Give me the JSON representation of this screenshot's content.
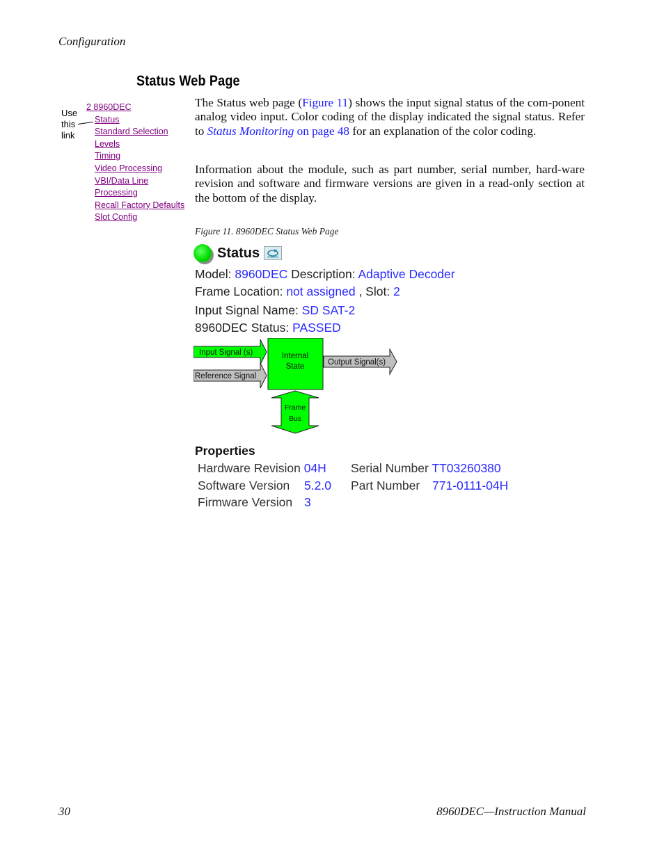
{
  "running_head": "Configuration",
  "section_title": "Status Web Page",
  "nav": {
    "callout": [
      "Use",
      "this",
      "link"
    ],
    "links": [
      {
        "label": "2 8960DEC",
        "indent": false
      },
      {
        "label": "Status",
        "indent": true
      },
      {
        "label": "Standard Selection",
        "indent": true
      },
      {
        "label": "Levels",
        "indent": true
      },
      {
        "label": "Timing",
        "indent": true
      },
      {
        "label": "Video Processing",
        "indent": true
      },
      {
        "label": "VBI/Data Line",
        "indent": true
      },
      {
        "label": "Processing",
        "indent": true
      },
      {
        "label": "Recall Factory Defaults",
        "indent": true
      },
      {
        "label": "Slot Config",
        "indent": true
      }
    ]
  },
  "paragraph1": {
    "t1": "The Status web page (",
    "link_figure": "Figure 11",
    "t2": ") shows the input signal status of the com-ponent analog video input. Color coding of the display indicated the signal status. Refer to ",
    "link_section": "Status Monitoring",
    "link_page": " on page 48",
    "t3": " for an explanation of the color coding."
  },
  "paragraph2": "Information about the module, such as part number, serial number, hard-ware revision and software and firmware versions are given in a read-only section at the bottom of the display.",
  "figure_caption": "Figure 11.  8960DEC Status Web Page",
  "status_page": {
    "title": "Status",
    "status_led_color": "#00e000",
    "model_label": "Model:",
    "model_value": "8960DEC",
    "description_label": "Description:",
    "description_value": "Adaptive Decoder",
    "frame_location_label": "Frame Location:",
    "frame_location_value": "not assigned",
    "slot_label": ", Slot:",
    "slot_value": "2",
    "input_signal_name_label": "Input Signal Name:",
    "input_signal_name_value": "SD SAT-2",
    "module_status_label": "8960DEC Status:",
    "module_status_value": "PASSED",
    "diagram": {
      "input_signal": "Input Signal (s)",
      "reference_signal": "Reference Signal",
      "internal_state_line1": "Internal",
      "internal_state_line2": "State",
      "output_signal": "Output Signal(s)",
      "frame_bus_line1": "Frame",
      "frame_bus_line2": "Bus",
      "colors": {
        "ok": "#00ff00",
        "inactive": "#c0c0c0"
      }
    },
    "properties": {
      "title": "Properties",
      "hardware_revision_label": "Hardware Revision",
      "hardware_revision_value": "04H",
      "software_version_label": "Software Version",
      "software_version_value": "5.2.0",
      "firmware_version_label": "Firmware Version",
      "firmware_version_value": "3",
      "serial_number_label": "Serial Number",
      "serial_number_value": "TT03260380",
      "part_number_label": "Part Number",
      "part_number_value": "771-0111-04H"
    }
  },
  "footer": {
    "page_number": "30",
    "manual_title": "8960DEC—Instruction Manual"
  }
}
